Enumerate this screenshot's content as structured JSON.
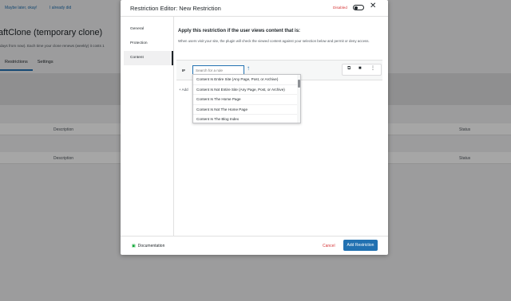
{
  "background": {
    "links": [
      "Maybe later, okay!",
      "I already did"
    ],
    "page_title": "aftClone (temporary clone)",
    "subtitle": "days from now). Each time your clone renews (weekly) it costs 1",
    "tabs": [
      {
        "label": "Restrictions"
      },
      {
        "label": "Settings"
      }
    ],
    "table_rows": [
      {
        "description": "Description",
        "status": "Status"
      },
      {
        "description": "Description",
        "status": "Status"
      }
    ]
  },
  "modal": {
    "title": "Restriction Editor: New Restriction",
    "status_label": "Disabled",
    "close_icon": "close-icon",
    "sidebar": [
      {
        "label": "General"
      },
      {
        "label": "Protection"
      },
      {
        "label": "Content",
        "active": true
      }
    ],
    "heading": "Apply this restriction if the user views content that is:",
    "description": "When users visit your site, the plugin will check the viewed content against your selection below and permit or deny access.",
    "rule": {
      "if_label": "IF",
      "search_placeholder": "Search for a rule",
      "add_hint": "+ Add",
      "actions": [
        "copy-icon",
        "trash-icon",
        "more-icon"
      ]
    },
    "dropdown_options": [
      "Content Is Entire Site (Any Page, Post, or Archive)",
      "Content Is Not Entire Site (Any Page, Post, or Archive)",
      "Content Is The Home Page",
      "Content Is Not The Home Page",
      "Content Is The Blog Index"
    ],
    "footer": {
      "documentation": "Documentation",
      "cancel": "Cancel",
      "add_restriction": "Add Restriction"
    },
    "colors": {
      "primary": "#2271b1",
      "danger": "#d63638",
      "doc_icon": "#00a32a"
    }
  }
}
